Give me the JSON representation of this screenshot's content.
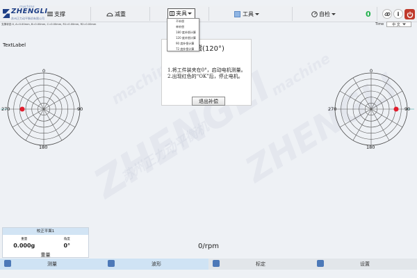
{
  "toolbar": {
    "logo": {
      "machine": "machine",
      "brand": "ZHENGLI",
      "company": "苏州正力动平衡机有限公司"
    },
    "support": "支撑",
    "unbalance": "减重",
    "fixture": "夹具",
    "tools": "工具",
    "selfcheck": "自检",
    "counter": "0",
    "info_icon": "i"
  },
  "status_line": "支撑状态:0, A=0.00mm, B=0.00mm, C=0.00mm, R1=0.00mm, R2=0.00mm",
  "time_label": "Time",
  "language": "中 文",
  "text_label": "TextLabel",
  "polar_labels": {
    "top": "0",
    "left": "270",
    "right": "90",
    "bottom": "180"
  },
  "dialog": {
    "title": "补偿(120°)",
    "line1": "1.将工件装夹在0°，启动电机测量。",
    "line2": "2.出现红色的“OK”后，停止电机。",
    "exit_button": "退出补偿"
  },
  "fixture_menu": [
    "不补偿",
    "单补偿",
    "180 度补偿计算",
    "120 度补偿计算",
    "90 度补偿计算",
    "72 度补偿计算"
  ],
  "watermark": {
    "brand": "ZHENGLI",
    "machine": "machine",
    "cn": "苏州正力动平衡机"
  },
  "correction_card": {
    "header": "校正平面1",
    "weight_label": "重量",
    "angle_label": "角度",
    "weight_value": "0.000g",
    "angle_value": "0°",
    "footer": "重量"
  },
  "rpm": "0/rpm",
  "bottom_tabs": [
    {
      "label": "测量",
      "icon": "ruler-icon"
    },
    {
      "label": "波形",
      "icon": "waveform-icon"
    },
    {
      "label": "标定",
      "icon": "star-icon"
    },
    {
      "label": "设置",
      "icon": "gear-icon"
    }
  ],
  "colors": {
    "marker": "#e11d2d",
    "accent": "#1f3f86",
    "ok_green": "#22b14c",
    "power": "#c0392b"
  }
}
